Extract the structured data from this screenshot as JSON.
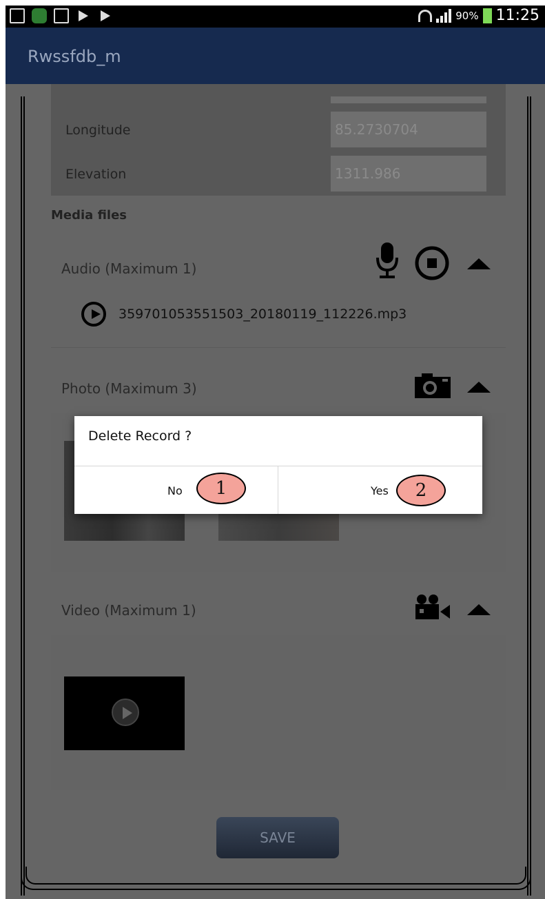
{
  "statusbar": {
    "battery": "90%",
    "time": "11:25"
  },
  "appbar": {
    "title": "Rwssfdb_m"
  },
  "location": {
    "longitude_label": "Longitude",
    "longitude_value": "85.2730704",
    "elevation_label": "Elevation",
    "elevation_value": "1311.986"
  },
  "media": {
    "title": "Media files",
    "audio": {
      "label": "Audio (Maximum 1)",
      "file": "359701053551503_20180119_112226.mp3"
    },
    "photo": {
      "label": "Photo (Maximum 3)"
    },
    "video": {
      "label": "Video (Maximum 1)"
    }
  },
  "save_label": "SAVE",
  "dialog": {
    "title": "Delete Record ?",
    "no_label": "No",
    "yes_label": "Yes"
  },
  "annotations": {
    "one": "1",
    "two": "2"
  },
  "icons": [
    "mic-icon",
    "stop-record-icon",
    "collapse-icon",
    "play-icon",
    "camera-icon",
    "video-camera-icon"
  ]
}
